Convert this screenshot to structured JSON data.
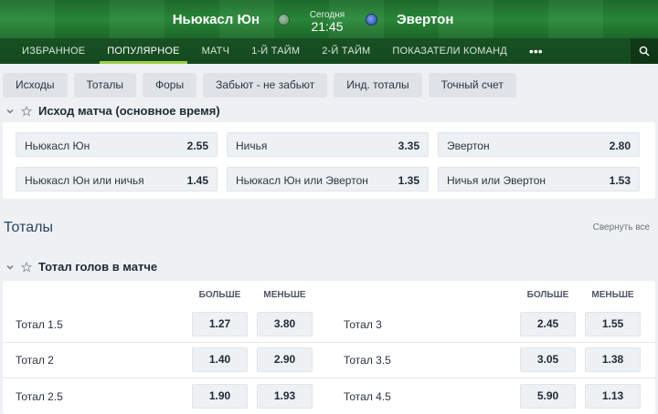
{
  "match": {
    "home": "Ньюкасл Юн",
    "away": "Эвертон",
    "day": "Сегодня",
    "time": "21:45",
    "home_logo_icon": "newcastle-crest-icon",
    "away_logo_icon": "everton-crest-icon"
  },
  "tabs": [
    "ИЗБРАННОЕ",
    "ПОПУЛЯРНОЕ",
    "МАТЧ",
    "1-Й ТАЙМ",
    "2-Й ТАЙМ",
    "ПОКАЗАТЕЛИ КОМАНД"
  ],
  "tabs_more": "•••",
  "active_tab": "ПОПУЛЯРНОЕ",
  "chips": [
    "Исходы",
    "Тоталы",
    "Форы",
    "Забьют - не забьют",
    "Инд. тоталы",
    "Точный счет"
  ],
  "outcome": {
    "title": "Исход матча (основное время)",
    "rows": [
      [
        {
          "name": "Ньюкасл Юн",
          "odd": "2.55"
        },
        {
          "name": "Ничья",
          "odd": "3.35"
        },
        {
          "name": "Эвертон",
          "odd": "2.80"
        }
      ],
      [
        {
          "name": "Ньюкасл Юн или ничья",
          "odd": "1.45"
        },
        {
          "name": "Ньюкасл Юн или Эвертон",
          "odd": "1.35"
        },
        {
          "name": "Ничья или Эвертон",
          "odd": "1.53"
        }
      ]
    ]
  },
  "totals": {
    "heading": "Тоталы",
    "collapse": "Свернуть все",
    "market_title": "Тотал голов в матче",
    "col_over": "БОЛЬШЕ",
    "col_under": "МЕНЬШЕ",
    "left": [
      {
        "label": "Тотал 1.5",
        "over": "1.27",
        "under": "3.80"
      },
      {
        "label": "Тотал 2",
        "over": "1.40",
        "under": "2.90"
      },
      {
        "label": "Тотал 2.5",
        "over": "1.90",
        "under": "1.93"
      }
    ],
    "right": [
      {
        "label": "Тотал 3",
        "over": "2.45",
        "under": "1.55"
      },
      {
        "label": "Тотал 3.5",
        "over": "3.05",
        "under": "1.38"
      },
      {
        "label": "Тотал 4.5",
        "over": "5.90",
        "under": "1.13"
      }
    ]
  },
  "colors": {
    "header_green": "#1f6d2c",
    "active_underline": "#9fd04a",
    "chip_bg": "#dfe3e8",
    "odd_bg": "#eef1f4"
  }
}
